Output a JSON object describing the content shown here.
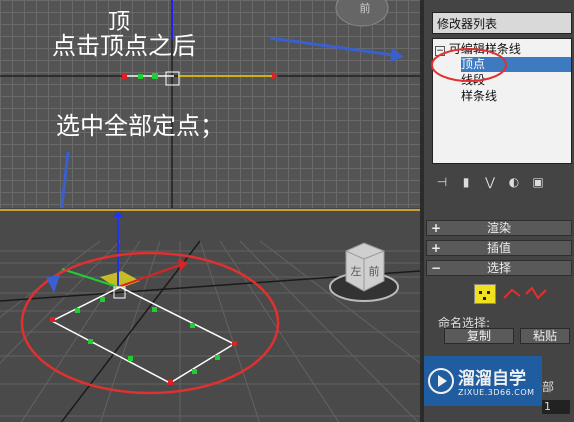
{
  "callouts": {
    "top_overlay": "顶",
    "step1": "点击顶点之后",
    "step2": "选中全部定点；"
  },
  "panel": {
    "modifier_list": "修改器列表",
    "stack": {
      "root": "可编辑样条线",
      "items": [
        "顶点",
        "线段",
        "样条线"
      ],
      "selected": "顶点"
    },
    "rollouts": {
      "render": "渲染",
      "interp": "插值",
      "select": "选择"
    },
    "named_selection_label": "命名选择:",
    "copy_button": "复制",
    "paste_button": "粘贴",
    "partial_label_1": "部",
    "partial_label_2": "1"
  },
  "viewcube": {
    "top_face": "前",
    "front_face": "前",
    "side_face": "左"
  },
  "watermark": {
    "title": "溜溜自学",
    "subtitle": "ZIXUE.3D66.COM"
  },
  "colors": {
    "annotation_red": "#e03030",
    "arrow_blue": "#3a5fcf",
    "vertex_green": "#22cc33",
    "vertex_red": "#dd2222",
    "selection_blue": "#3d7ac0"
  }
}
